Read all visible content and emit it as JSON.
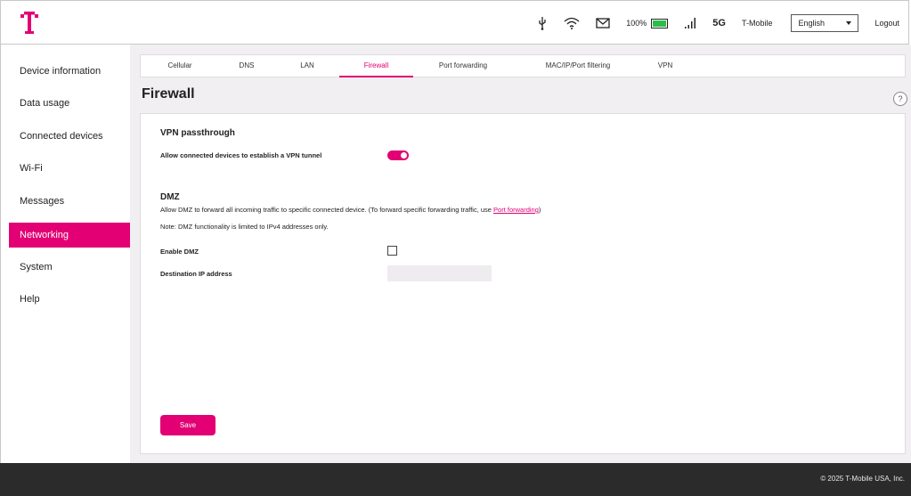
{
  "header": {
    "status": {
      "battery_percent": "100%",
      "battery_level": 1.0,
      "network_type": "5G",
      "carrier": "T-Mobile"
    },
    "language": {
      "selected": "English"
    },
    "logout_label": "Logout"
  },
  "sidebar": {
    "items": [
      {
        "label": "Device information"
      },
      {
        "label": "Data usage"
      },
      {
        "label": "Connected devices"
      },
      {
        "label": "Wi-Fi"
      },
      {
        "label": "Messages"
      },
      {
        "label": "Networking",
        "active": true
      },
      {
        "label": "System"
      },
      {
        "label": "Help"
      }
    ]
  },
  "tabs": [
    {
      "label": "Cellular"
    },
    {
      "label": "DNS"
    },
    {
      "label": "LAN"
    },
    {
      "label": "Firewall",
      "active": true
    },
    {
      "label": "Port forwarding"
    },
    {
      "label": "MAC/IP/Port filtering"
    },
    {
      "label": "VPN"
    }
  ],
  "page": {
    "title": "Firewall",
    "help_label": "?",
    "vpn": {
      "heading": "VPN passthrough",
      "allow_label": "Allow connected devices to establish a VPN tunnel",
      "enabled": true
    },
    "dmz": {
      "heading": "DMZ",
      "description_prefix": "Allow DMZ to forward all incoming traffic to specific connected device. (To forward specific forwarding traffic, use ",
      "description_link": "Port forwarding",
      "description_suffix": ")",
      "note": "Note: DMZ functionality is limited to IPv4 addresses only.",
      "enable_label": "Enable DMZ",
      "enabled": false,
      "ip_label": "Destination IP address",
      "ip_value": ""
    },
    "save_label": "Save"
  },
  "footer": {
    "copyright": "© 2025 T-Mobile USA, Inc."
  },
  "colors": {
    "brand": "#e20074",
    "background": "#f2eff2",
    "footer": "#2b2b2b"
  }
}
